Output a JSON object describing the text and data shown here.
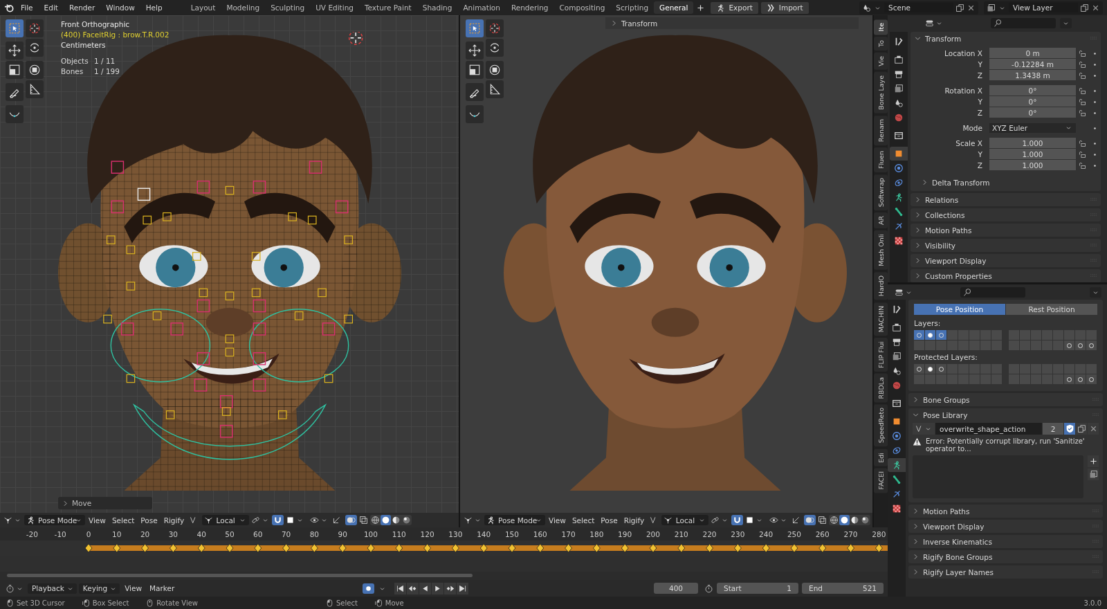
{
  "top_bar": {
    "menus": [
      "File",
      "Edit",
      "Render",
      "Window",
      "Help"
    ],
    "workspaces": [
      {
        "label": "Layout",
        "selected": false
      },
      {
        "label": "Modeling",
        "selected": false
      },
      {
        "label": "Sculpting",
        "selected": false
      },
      {
        "label": "UV Editing",
        "selected": false
      },
      {
        "label": "Texture Paint",
        "selected": false
      },
      {
        "label": "Shading",
        "selected": false
      },
      {
        "label": "Animation",
        "selected": false
      },
      {
        "label": "Rendering",
        "selected": false
      },
      {
        "label": "Compositing",
        "selected": false
      },
      {
        "label": "Scripting",
        "selected": false
      },
      {
        "label": "General",
        "selected": true
      }
    ],
    "buttons": [
      {
        "kind": "export",
        "label": "Export"
      },
      {
        "kind": "import",
        "label": "Import"
      }
    ],
    "scene": "Scene",
    "view_layer": "View Layer"
  },
  "viewports": [
    {
      "kind": "wireframe",
      "overlay": [
        "Front Orthographic",
        "(400) FaceitRig : brow.T.R.002",
        "Centimeters"
      ],
      "stats": [
        {
          "label": "Objects",
          "value": "1 / 11"
        },
        {
          "label": "Bones",
          "value": "1 / 199"
        }
      ],
      "operator_panel": "Move",
      "tools": [
        {
          "kind": "select",
          "selected": true
        },
        {
          "kind": "cursor",
          "selected": false
        },
        {
          "kind": "move",
          "selected": false
        },
        {
          "kind": "rotate",
          "selected": false
        },
        {
          "kind": "scale",
          "selected": false
        },
        {
          "kind": "transform",
          "selected": false
        },
        {
          "kind": "annotate",
          "selected": false
        },
        {
          "kind": "measure",
          "selected": false
        },
        {
          "kind": "curve",
          "selected": false
        }
      ],
      "header": {
        "mode": "Pose Mode",
        "menus": [
          "View",
          "Select",
          "Pose",
          "Rigify"
        ],
        "orientation": "Local",
        "shading": [
          {
            "kind": "wire",
            "selected": false
          },
          {
            "kind": "solid",
            "selected": true
          },
          {
            "kind": "material",
            "selected": false
          },
          {
            "kind": "rendered",
            "selected": false
          }
        ]
      }
    },
    {
      "kind": "solid",
      "panel_title": "Transform",
      "tools": [
        {
          "kind": "select",
          "selected": true
        },
        {
          "kind": "cursor",
          "selected": false
        },
        {
          "kind": "move",
          "selected": false
        },
        {
          "kind": "rotate",
          "selected": false
        },
        {
          "kind": "scale",
          "selected": false
        },
        {
          "kind": "transform",
          "selected": false
        },
        {
          "kind": "annotate",
          "selected": false
        },
        {
          "kind": "measure",
          "selected": false
        },
        {
          "kind": "curve",
          "selected": false
        }
      ],
      "header": {
        "mode": "Pose Mode",
        "menus": [
          "View",
          "Select",
          "Pose",
          "Rigify"
        ],
        "orientation": "Local",
        "shading": [
          {
            "kind": "wire",
            "selected": false
          },
          {
            "kind": "solid",
            "selected": true
          },
          {
            "kind": "material",
            "selected": false
          },
          {
            "kind": "rendered",
            "selected": false
          }
        ]
      }
    }
  ],
  "side_tabs": [
    {
      "label": "Ite",
      "selected": true
    },
    {
      "label": "To",
      "selected": false
    },
    {
      "label": "Vie",
      "selected": false
    },
    {
      "label": "Bone Laye",
      "selected": false
    },
    {
      "label": "Renam",
      "selected": false
    },
    {
      "label": "Fluen",
      "selected": false
    },
    {
      "label": "Softwrap",
      "selected": false
    },
    {
      "label": "AR",
      "selected": false
    },
    {
      "label": "Mesh Onli",
      "selected": false
    },
    {
      "label": "HardO",
      "selected": false
    },
    {
      "label": "MACHIN",
      "selected": false
    },
    {
      "label": "FLIP Flui",
      "selected": false
    },
    {
      "label": "RBDLa",
      "selected": false
    },
    {
      "label": "SpeedReto",
      "selected": false
    },
    {
      "label": "Edi",
      "selected": false
    },
    {
      "label": "FACEI",
      "selected": false
    }
  ],
  "properties_object": {
    "tabs": [
      {
        "kind": "tool",
        "selected": false
      },
      {
        "kind": "render",
        "selected": false
      },
      {
        "kind": "output",
        "selected": false
      },
      {
        "kind": "view_layer",
        "selected": false
      },
      {
        "kind": "scene",
        "selected": false
      },
      {
        "kind": "world",
        "selected": false
      },
      {
        "kind": "collection",
        "selected": false
      },
      {
        "kind": "object",
        "selected": true
      },
      {
        "kind": "modifier",
        "selected": false
      },
      {
        "kind": "physics",
        "selected": false
      },
      {
        "kind": "pose",
        "selected": false
      },
      {
        "kind": "bone",
        "selected": false
      },
      {
        "kind": "constraint",
        "selected": false
      },
      {
        "kind": "texture",
        "selected": false
      }
    ],
    "transform": {
      "title": "Transform",
      "expanded": true,
      "groups": [
        [
          {
            "kind": "number",
            "label": "Location X",
            "value": "0 m"
          },
          {
            "kind": "number",
            "label": "Y",
            "value": "-0.12284 m"
          },
          {
            "kind": "number",
            "label": "Z",
            "value": "1.3438 m"
          }
        ],
        [
          {
            "kind": "number",
            "label": "Rotation X",
            "value": "0°"
          },
          {
            "kind": "number",
            "label": "Y",
            "value": "0°"
          },
          {
            "kind": "number",
            "label": "Z",
            "value": "0°"
          }
        ],
        [
          {
            "kind": "dropdown",
            "label": "Mode",
            "value": "XYZ Euler"
          }
        ],
        [
          {
            "kind": "number",
            "label": "Scale X",
            "value": "1.000"
          },
          {
            "kind": "number",
            "label": "Y",
            "value": "1.000"
          },
          {
            "kind": "number",
            "label": "Z",
            "value": "1.000"
          }
        ]
      ],
      "subpanel": {
        "title": "Delta Transform",
        "expanded": false
      }
    },
    "panels": [
      {
        "title": "Relations",
        "expanded": false
      },
      {
        "title": "Collections",
        "expanded": false
      },
      {
        "title": "Motion Paths",
        "expanded": false
      },
      {
        "title": "Visibility",
        "expanded": false
      },
      {
        "title": "Viewport Display",
        "expanded": false
      },
      {
        "title": "Custom Properties",
        "expanded": false
      }
    ]
  },
  "properties_armature": {
    "tabs": [
      {
        "kind": "tool",
        "selected": false
      },
      {
        "kind": "render",
        "selected": false
      },
      {
        "kind": "output",
        "selected": false
      },
      {
        "kind": "view_layer",
        "selected": false
      },
      {
        "kind": "scene",
        "selected": false
      },
      {
        "kind": "world",
        "selected": false
      },
      {
        "kind": "collection",
        "selected": false
      },
      {
        "kind": "object",
        "selected": false
      },
      {
        "kind": "modifier",
        "selected": false
      },
      {
        "kind": "physics",
        "selected": false
      },
      {
        "kind": "pose",
        "selected": true
      },
      {
        "kind": "bone",
        "selected": false
      },
      {
        "kind": "constraint",
        "selected": false
      },
      {
        "kind": "texture",
        "selected": false
      }
    ],
    "position": [
      {
        "label": "Pose Position",
        "selected": true
      },
      {
        "label": "Rest Position",
        "selected": false
      }
    ],
    "layers_label": "Layers:",
    "layers": [
      {
        "selected": true,
        "used": true,
        "active": false
      },
      {
        "selected": true,
        "used": true,
        "active": true
      },
      {
        "selected": true,
        "used": true,
        "active": false
      },
      {
        "selected": false,
        "used": false,
        "active": false
      },
      {
        "selected": false,
        "used": false,
        "active": false
      },
      {
        "selected": false,
        "used": false,
        "active": false
      },
      {
        "selected": false,
        "used": false,
        "active": false
      },
      {
        "selected": false,
        "used": false,
        "active": false
      },
      {
        "selected": false,
        "used": false,
        "active": false
      },
      {
        "selected": false,
        "used": false,
        "active": false
      },
      {
        "selected": false,
        "used": false,
        "active": false
      },
      {
        "selected": false,
        "used": false,
        "active": false
      },
      {
        "selected": false,
        "used": false,
        "active": false
      },
      {
        "selected": false,
        "used": false,
        "active": false
      },
      {
        "selected": false,
        "used": false,
        "active": false
      },
      {
        "selected": false,
        "used": false,
        "active": false
      },
      {
        "selected": false,
        "used": false,
        "active": false
      },
      {
        "selected": false,
        "used": false,
        "active": false
      },
      {
        "selected": false,
        "used": false,
        "active": false
      },
      {
        "selected": false,
        "used": false,
        "active": false
      },
      {
        "selected": false,
        "used": false,
        "active": false
      },
      {
        "selected": false,
        "used": false,
        "active": false
      },
      {
        "selected": false,
        "used": false,
        "active": false
      },
      {
        "selected": false,
        "used": false,
        "active": false
      },
      {
        "selected": false,
        "used": false,
        "active": false
      },
      {
        "selected": false,
        "used": false,
        "active": false
      },
      {
        "selected": false,
        "used": false,
        "active": false
      },
      {
        "selected": false,
        "used": false,
        "active": false
      },
      {
        "selected": false,
        "used": false,
        "active": false
      },
      {
        "selected": false,
        "used": true,
        "active": false
      },
      {
        "selected": false,
        "used": true,
        "active": false
      },
      {
        "selected": false,
        "used": true,
        "active": false
      }
    ],
    "protected_label": "Protected Layers:",
    "protected_layers": [
      {
        "selected": false,
        "used": true,
        "active": false
      },
      {
        "selected": false,
        "used": true,
        "active": true
      },
      {
        "selected": false,
        "used": true,
        "active": false
      },
      {
        "selected": false,
        "used": false,
        "active": false
      },
      {
        "selected": false,
        "used": false,
        "active": false
      },
      {
        "selected": false,
        "used": false,
        "active": false
      },
      {
        "selected": false,
        "used": false,
        "active": false
      },
      {
        "selected": false,
        "used": false,
        "active": false
      },
      {
        "selected": false,
        "used": false,
        "active": false
      },
      {
        "selected": false,
        "used": false,
        "active": false
      },
      {
        "selected": false,
        "used": false,
        "active": false
      },
      {
        "selected": false,
        "used": false,
        "active": false
      },
      {
        "selected": false,
        "used": false,
        "active": false
      },
      {
        "selected": false,
        "used": false,
        "active": false
      },
      {
        "selected": false,
        "used": false,
        "active": false
      },
      {
        "selected": false,
        "used": false,
        "active": false
      },
      {
        "selected": false,
        "used": false,
        "active": false
      },
      {
        "selected": false,
        "used": false,
        "active": false
      },
      {
        "selected": false,
        "used": false,
        "active": false
      },
      {
        "selected": false,
        "used": false,
        "active": false
      },
      {
        "selected": false,
        "used": false,
        "active": false
      },
      {
        "selected": false,
        "used": false,
        "active": false
      },
      {
        "selected": false,
        "used": false,
        "active": false
      },
      {
        "selected": false,
        "used": false,
        "active": false
      },
      {
        "selected": false,
        "used": false,
        "active": false
      },
      {
        "selected": false,
        "used": false,
        "active": false
      },
      {
        "selected": false,
        "used": false,
        "active": false
      },
      {
        "selected": false,
        "used": false,
        "active": false
      },
      {
        "selected": false,
        "used": false,
        "active": false
      },
      {
        "selected": false,
        "used": true,
        "active": false
      },
      {
        "selected": false,
        "used": true,
        "active": false
      },
      {
        "selected": false,
        "used": true,
        "active": false
      }
    ],
    "panels_before": [
      {
        "title": "Bone Groups",
        "expanded": false
      }
    ],
    "pose_library": {
      "title": "Pose Library",
      "expanded": true,
      "action": "overwrite_shape_action",
      "users": "2",
      "fake_user": true,
      "error": "Error: Potentially corrupt library, run 'Sanitize' operator to..."
    },
    "panels_after": [
      {
        "title": "Motion Paths",
        "expanded": false
      },
      {
        "title": "Viewport Display",
        "expanded": false
      },
      {
        "title": "Inverse Kinematics",
        "expanded": false
      },
      {
        "title": "Rigify Bone Groups",
        "expanded": false
      },
      {
        "title": "Rigify Layer Names",
        "expanded": false
      }
    ]
  },
  "timeline": {
    "ruler": [
      "-20",
      "-10",
      "0",
      "10",
      "20",
      "30",
      "40",
      "50",
      "60",
      "70",
      "80",
      "90",
      "100",
      "110",
      "120",
      "130",
      "140",
      "150",
      "160",
      "170",
      "180",
      "190",
      "200",
      "210",
      "220",
      "230",
      "240",
      "250",
      "260",
      "270",
      "280"
    ],
    "menus": [
      {
        "label": "Playback",
        "dropdown": true
      },
      {
        "label": "Keying",
        "dropdown": true
      },
      {
        "label": "View",
        "dropdown": false
      },
      {
        "label": "Marker",
        "dropdown": false
      }
    ],
    "auto_keying": true,
    "current_frame": "400",
    "start_label": "Start",
    "start": "1",
    "end_label": "End",
    "end": "521"
  },
  "status_bar": {
    "hints_left": [
      {
        "kind": "left",
        "label": "Set 3D Cursor"
      },
      {
        "kind": "drag",
        "label": "Box Select"
      },
      {
        "kind": "middle",
        "label": "Rotate View"
      }
    ],
    "hints_right": [
      {
        "kind": "left",
        "label": "Select"
      },
      {
        "kind": "drag",
        "label": "Move"
      }
    ],
    "version": "3.0.0"
  }
}
